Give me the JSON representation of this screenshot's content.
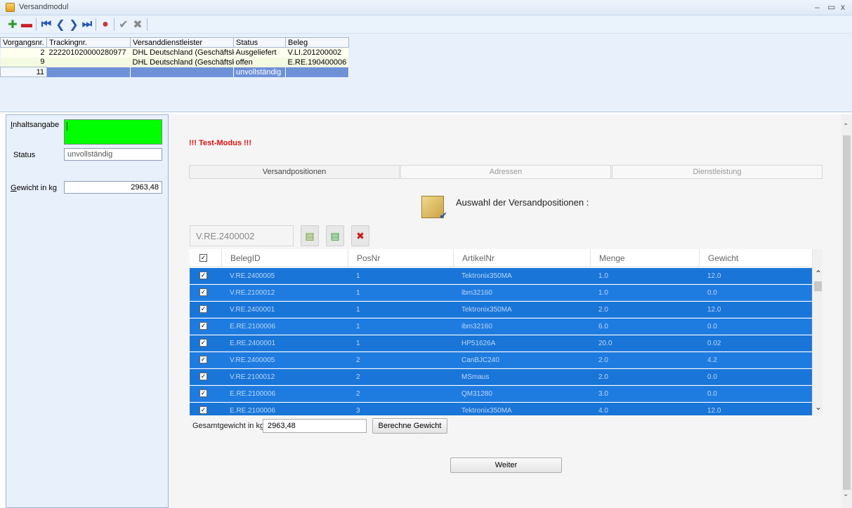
{
  "window": {
    "title": "Versandmodul",
    "minimize": "–",
    "maximize": "▭",
    "close": "x"
  },
  "toolbar": {
    "buttons": [
      {
        "name": "add-icon",
        "glyph": "✚",
        "color": "#2e9a2e"
      },
      {
        "name": "remove-icon",
        "glyph": "▬",
        "color": "#c82020"
      },
      {
        "name": "first-icon",
        "glyph": "⏮",
        "color": "#2a55b0"
      },
      {
        "name": "prev-icon",
        "glyph": "❮",
        "color": "#2a55b0"
      },
      {
        "name": "next-icon",
        "glyph": "❯",
        "color": "#2a55b0"
      },
      {
        "name": "last-icon",
        "glyph": "⏭",
        "color": "#2a55b0"
      },
      {
        "name": "refresh-icon",
        "glyph": "●",
        "color": "#c83a3a"
      },
      {
        "name": "confirm-icon",
        "glyph": "✔",
        "color": "#8a8a8a"
      },
      {
        "name": "cancel-icon",
        "glyph": "✖",
        "color": "#8a8a8a"
      }
    ]
  },
  "vorgaenge": {
    "columns": [
      "Vorgangsnr.",
      "Trackingnr.",
      "Versanddienstleister",
      "Status",
      "Beleg"
    ],
    "rows": [
      [
        "2",
        "222201020000280977",
        "DHL Deutschland (Geschäftskun",
        "Ausgeliefert",
        "V.LI.201200002"
      ],
      [
        "9",
        "",
        "DHL Deutschland (Geschäftskun",
        "offen",
        "E.RE.190400006"
      ],
      [
        "11",
        "",
        "",
        "unvollständig",
        ""
      ]
    ]
  },
  "left": {
    "inhalt_label_first": "I",
    "inhalt_label_rest": "nhaltsangabe",
    "status_label": "Status",
    "status_value": "unvollständig",
    "gewicht_label_first": "G",
    "gewicht_label_rest": "ewicht in kg",
    "gewicht_value": "2963,48"
  },
  "main": {
    "test_mode": "!!! Test-Modus !!!",
    "tabs": [
      "Versandpositionen",
      "Adressen",
      "Dienstleistung"
    ],
    "active_tab": 0,
    "section_title": "Auswahl der Versandpositionen :",
    "beleg_input": "V.RE.2400002",
    "grid": {
      "columns": [
        "BelegID",
        "PosNr",
        "ArtikelNr",
        "Menge",
        "Gewicht"
      ],
      "rows": [
        [
          "V.RE.2400005",
          "1",
          "Tektronix350MA",
          "1.0",
          "12.0"
        ],
        [
          "V.RE.2100012",
          "1",
          "ibm32160",
          "1.0",
          "0.0"
        ],
        [
          "V.RE.2400001",
          "1",
          "Tektronix350MA",
          "2.0",
          "12.0"
        ],
        [
          "E.RE.2100006",
          "1",
          "ibm32160",
          "6.0",
          "0.0"
        ],
        [
          "E.RE.2400001",
          "1",
          "HP51626A",
          "20.0",
          "0.02"
        ],
        [
          "V.RE.2400005",
          "2",
          "CanBJC240",
          "2.0",
          "4.2"
        ],
        [
          "V.RE.2100012",
          "2",
          "MSmaus",
          "2.0",
          "0.0"
        ],
        [
          "E.RE.2100006",
          "2",
          "QM31280",
          "3.0",
          "0.0"
        ],
        [
          "E.RE.2100006",
          "3",
          "Tektronix350MA",
          "4.0",
          "12.0"
        ]
      ]
    },
    "gesamt_label": "Gesamtgewicht in kg",
    "gesamt_value": "2963,48",
    "berechne_label": "Berechne Gewicht",
    "weiter_label": "Weiter"
  }
}
